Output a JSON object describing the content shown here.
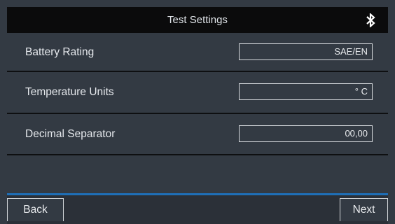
{
  "header": {
    "title": "Test Settings",
    "status_icon": "bluetooth-icon"
  },
  "settings": [
    {
      "label": "Battery Rating",
      "value": "SAE/EN"
    },
    {
      "label": "Temperature Units",
      "value": "° C"
    },
    {
      "label": "Decimal Separator",
      "value": "00,00"
    }
  ],
  "footer": {
    "back_label": "Back",
    "next_label": "Next"
  },
  "colors": {
    "title_bar": "#0b0b0c",
    "panel": "#333a43",
    "accent_rule": "#1f6fb7",
    "text": "#e6e9ed"
  }
}
